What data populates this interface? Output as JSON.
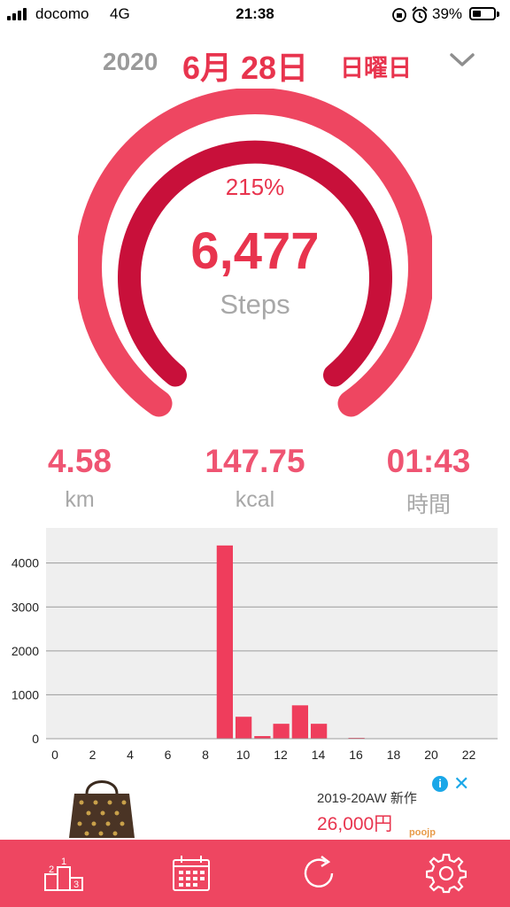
{
  "status_bar": {
    "carrier": "docomo",
    "network": "4G",
    "time": "21:38",
    "battery": "39%"
  },
  "date": {
    "year": "2020",
    "day": "6月 28日",
    "weekday": "日曜日"
  },
  "gauge": {
    "percent": "215%",
    "steps": "6,477",
    "steps_label": "Steps",
    "progress_fraction": 1.0
  },
  "stats": {
    "distance": {
      "value": "4.58",
      "unit": "km"
    },
    "calories": {
      "value": "147.75",
      "unit": "kcal"
    },
    "duration": {
      "value": "01:43",
      "unit": "時間"
    }
  },
  "chart_data": {
    "type": "bar",
    "x": [
      0,
      1,
      2,
      3,
      4,
      5,
      6,
      7,
      8,
      9,
      10,
      11,
      12,
      13,
      14,
      15,
      16,
      17,
      18,
      19,
      20,
      21,
      22,
      23
    ],
    "values": [
      0,
      0,
      0,
      0,
      0,
      0,
      0,
      0,
      0,
      4400,
      500,
      60,
      340,
      760,
      340,
      0,
      20,
      0,
      0,
      0,
      0,
      0,
      0,
      0
    ],
    "x_ticks": [
      "0",
      "2",
      "4",
      "6",
      "8",
      "10",
      "12",
      "14",
      "16",
      "18",
      "20",
      "22"
    ],
    "y_ticks": [
      "0",
      "1000",
      "2000",
      "3000",
      "4000"
    ],
    "ylim": [
      0,
      4800
    ],
    "grid": true,
    "color": "#ef3d5c"
  },
  "ad": {
    "season": "2019-20AW 新作",
    "price": "26,000円",
    "brand": "poojp"
  },
  "tabbar": {
    "items": [
      "ranking-icon",
      "calendar-icon",
      "refresh-icon",
      "gear-icon"
    ]
  },
  "colors": {
    "accent": "#e8344e",
    "outer_ring": "#ee4661",
    "inner_ring": "#c8103a",
    "tabbar": "#ee4661"
  }
}
